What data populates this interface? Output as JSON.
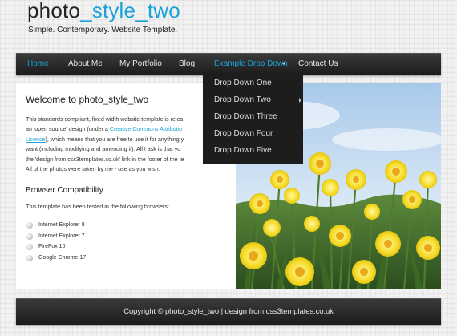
{
  "header": {
    "logo_part1": "photo",
    "logo_part2": "_style_two",
    "slogan": "Simple. Contemporary. Website Template."
  },
  "nav": {
    "items": [
      {
        "label": "Home",
        "active": true
      },
      {
        "label": "About Me"
      },
      {
        "label": "My Portfolio"
      },
      {
        "label": "Blog"
      },
      {
        "label": "Example Drop Down",
        "has_dropdown": true
      },
      {
        "label": "Contact Us"
      }
    ],
    "dropdown": [
      "Drop Down One",
      "Drop Down Two",
      "Drop Down Three",
      "Drop Down Four",
      "Drop Down Five"
    ]
  },
  "content": {
    "heading": "Welcome to photo_style_two",
    "para_lines": [
      "This standards compliant, fixed width website template is relea",
      "an 'open source' design (under a ",
      "Creative Commons Attributio",
      "Licence",
      "), which means that you are free to use it for anything y",
      "want (including modifying and amending it). All I ask is that yo",
      "the 'design from css3templates.co.uk' link in the footer of the te",
      "All of the photos were taken by me - use as you wish."
    ],
    "compat_heading": "Browser Compatibility",
    "compat_text": "This template has been tested in the following browsers:",
    "browsers": [
      "Internet Explorer 8",
      "Internet Explorer 7",
      "FireFox 10",
      "Google Chrome 17"
    ]
  },
  "footer": {
    "text": "Copyright © photo_style_two | design from css3templates.co.uk"
  },
  "colors": {
    "accent": "#1aa3d8",
    "nav_bg": "#2a2a2a",
    "body_bg": "#f1f1f1"
  }
}
